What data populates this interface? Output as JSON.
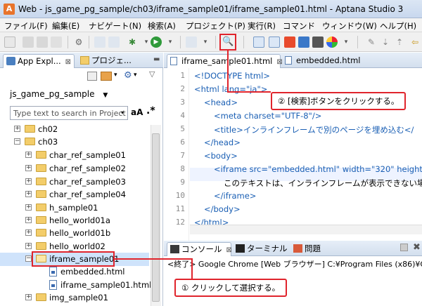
{
  "window": {
    "title": "Web - js_game_pg_sample/ch03/iframe_sample01/iframe_sample01.html - Aptana Studio 3"
  },
  "menubar": [
    "ファイル(F)",
    "編集(E)",
    "ナビゲート(N)",
    "検索(A)",
    "プロジェクト(P)",
    "実行(R)",
    "コマンド",
    "ウィンドウ(W)",
    "ヘルプ(H)"
  ],
  "left_panel": {
    "tabs": [
      {
        "label": "App Expl...",
        "icon": "app-explorer-icon"
      },
      {
        "label": "プロジェ...",
        "icon": "project-icon"
      }
    ],
    "project_name": "js_game_pg_sample",
    "search_placeholder": "Type text to search in Project",
    "case_button": "aA",
    "regex_button": ".*",
    "tree": [
      {
        "label": "ch02",
        "type": "folder",
        "expand": "+"
      },
      {
        "label": "ch03",
        "type": "folder",
        "expand": "−"
      },
      {
        "label": "char_ref_sample01",
        "type": "folder",
        "expand": "+"
      },
      {
        "label": "char_ref_sample02",
        "type": "folder",
        "expand": "+"
      },
      {
        "label": "char_ref_sample03",
        "type": "folder",
        "expand": "+"
      },
      {
        "label": "char_ref_sample04",
        "type": "folder",
        "expand": "+"
      },
      {
        "label": "h_sample01",
        "type": "folder",
        "expand": "+"
      },
      {
        "label": "hello_world01a",
        "type": "folder",
        "expand": "+"
      },
      {
        "label": "hello_world01b",
        "type": "folder",
        "expand": "+"
      },
      {
        "label": "hello_world02",
        "type": "folder",
        "expand": "+"
      },
      {
        "label": "iframe_sample01",
        "type": "folder",
        "expand": "−"
      },
      {
        "label": "embedded.html",
        "type": "file",
        "expand": ""
      },
      {
        "label": "iframe_sample01.html",
        "type": "file",
        "expand": ""
      },
      {
        "label": "img_sample01",
        "type": "folder",
        "expand": "+"
      }
    ]
  },
  "editor": {
    "tabs": [
      {
        "label": "iframe_sample01.html",
        "close": "⊠"
      },
      {
        "label": "embedded.html",
        "close": ""
      }
    ],
    "line_numbers": [
      "1",
      "2",
      "3",
      "4",
      "5",
      "6",
      "7",
      "8",
      "9",
      "10",
      "11",
      "12"
    ],
    "lines": [
      "<!DOCTYPE html>",
      "<html lang=\"ja\">",
      "<head>",
      "<meta charset=\"UTF-8\"/>",
      "<title>インラインフレームで別のページを埋め込む</",
      "</head>",
      "<body>",
      "<iframe src=\"embedded.html\" width=\"320\" height=",
      "このテキストは、インラインフレームが表示できない場",
      "</iframe>",
      "</body>",
      "</html>"
    ]
  },
  "bottom_panel": {
    "tabs": [
      "コンソール",
      "ターミナル",
      "問題"
    ],
    "console_text": "<終了> Google Chrome [Web ブラウザー] C:¥Program Files (x86)¥Go"
  },
  "annotations": {
    "step1": "① クリックして選択する。",
    "step2": "② [検索]ボタンをクリックする。"
  },
  "colors": {
    "callout_red": "#e0242c",
    "selection": "#cfe3fb",
    "tag_blue": "#1a5fb4"
  }
}
